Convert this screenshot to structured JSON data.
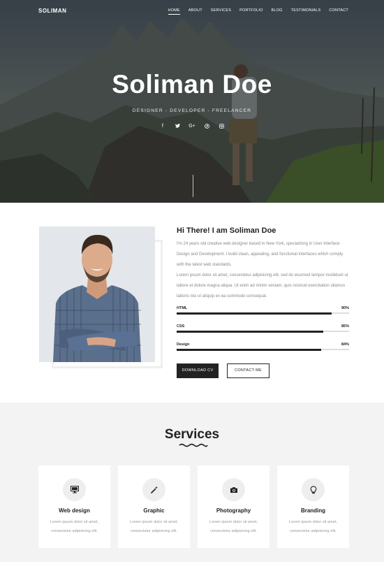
{
  "nav": {
    "brand": "SOLIMAN",
    "items": [
      {
        "label": "HOME"
      },
      {
        "label": "ABOUT"
      },
      {
        "label": "SERVICES"
      },
      {
        "label": "PORTFOLIO"
      },
      {
        "label": "BLOG"
      },
      {
        "label": "TESTIMONIALS"
      },
      {
        "label": "CONTACT"
      }
    ]
  },
  "hero": {
    "title": "Soliman Doe",
    "subtitle": "DESIGNER  -  DEVELOPER  -  FREELANCER",
    "socials": [
      {
        "icon": "facebook-icon",
        "glyph": "f"
      },
      {
        "icon": "twitter-icon",
        "glyph": "🐦"
      },
      {
        "icon": "google-plus-icon",
        "glyph": "G+"
      },
      {
        "icon": "pinterest-icon",
        "glyph": "℗"
      },
      {
        "icon": "instagram-icon",
        "glyph": "◎"
      }
    ]
  },
  "about": {
    "heading": "Hi There! I am Soliman Doe",
    "paragraph1": "I'm 24 years old creative web designer based in New York, specializing in User Interface Design and Development. I build clean, appealing, and functional interfaces which comply with the latest web standards.",
    "paragraph2": "Lorem ipsum dolor sit amet, consectetur adipisicing elit, sed do eiusmod tempor incididunt ut labore et dolore magna aliqua. Ut enim ad minim veniam, quis nostrud exercitation ullamco laboris nisi ut aliquip ex ea commodo consequat.",
    "skills": [
      {
        "name": "HTML",
        "percent_label": "90%",
        "percent": 90
      },
      {
        "name": "CSS",
        "percent_label": "85%",
        "percent": 85
      },
      {
        "name": "Design",
        "percent_label": "84%",
        "percent": 84
      }
    ],
    "download_label": "DOWNLOAD CV",
    "contact_label": "CONTACT ME"
  },
  "services": {
    "title": "Services",
    "cards": [
      {
        "icon": "monitor-icon",
        "title": "Web design",
        "desc": "Lorem ipsum dolor sit amet, consectetur adipisicing elit."
      },
      {
        "icon": "magic-wand-icon",
        "title": "Graphic",
        "desc": "Lorem ipsum dolor sit amet, consectetur adipisicing elit."
      },
      {
        "icon": "camera-icon",
        "title": "Photography",
        "desc": "Lorem ipsum dolor sit amet, consectetur adipisicing elit."
      },
      {
        "icon": "lightbulb-icon",
        "title": "Branding",
        "desc": "Lorem ipsum dolor sit amet, consectetur adipisicing elit."
      }
    ]
  },
  "colors": {
    "dark": "#222222",
    "muted_text": "#888888",
    "section_bg": "#f3f3f3"
  }
}
